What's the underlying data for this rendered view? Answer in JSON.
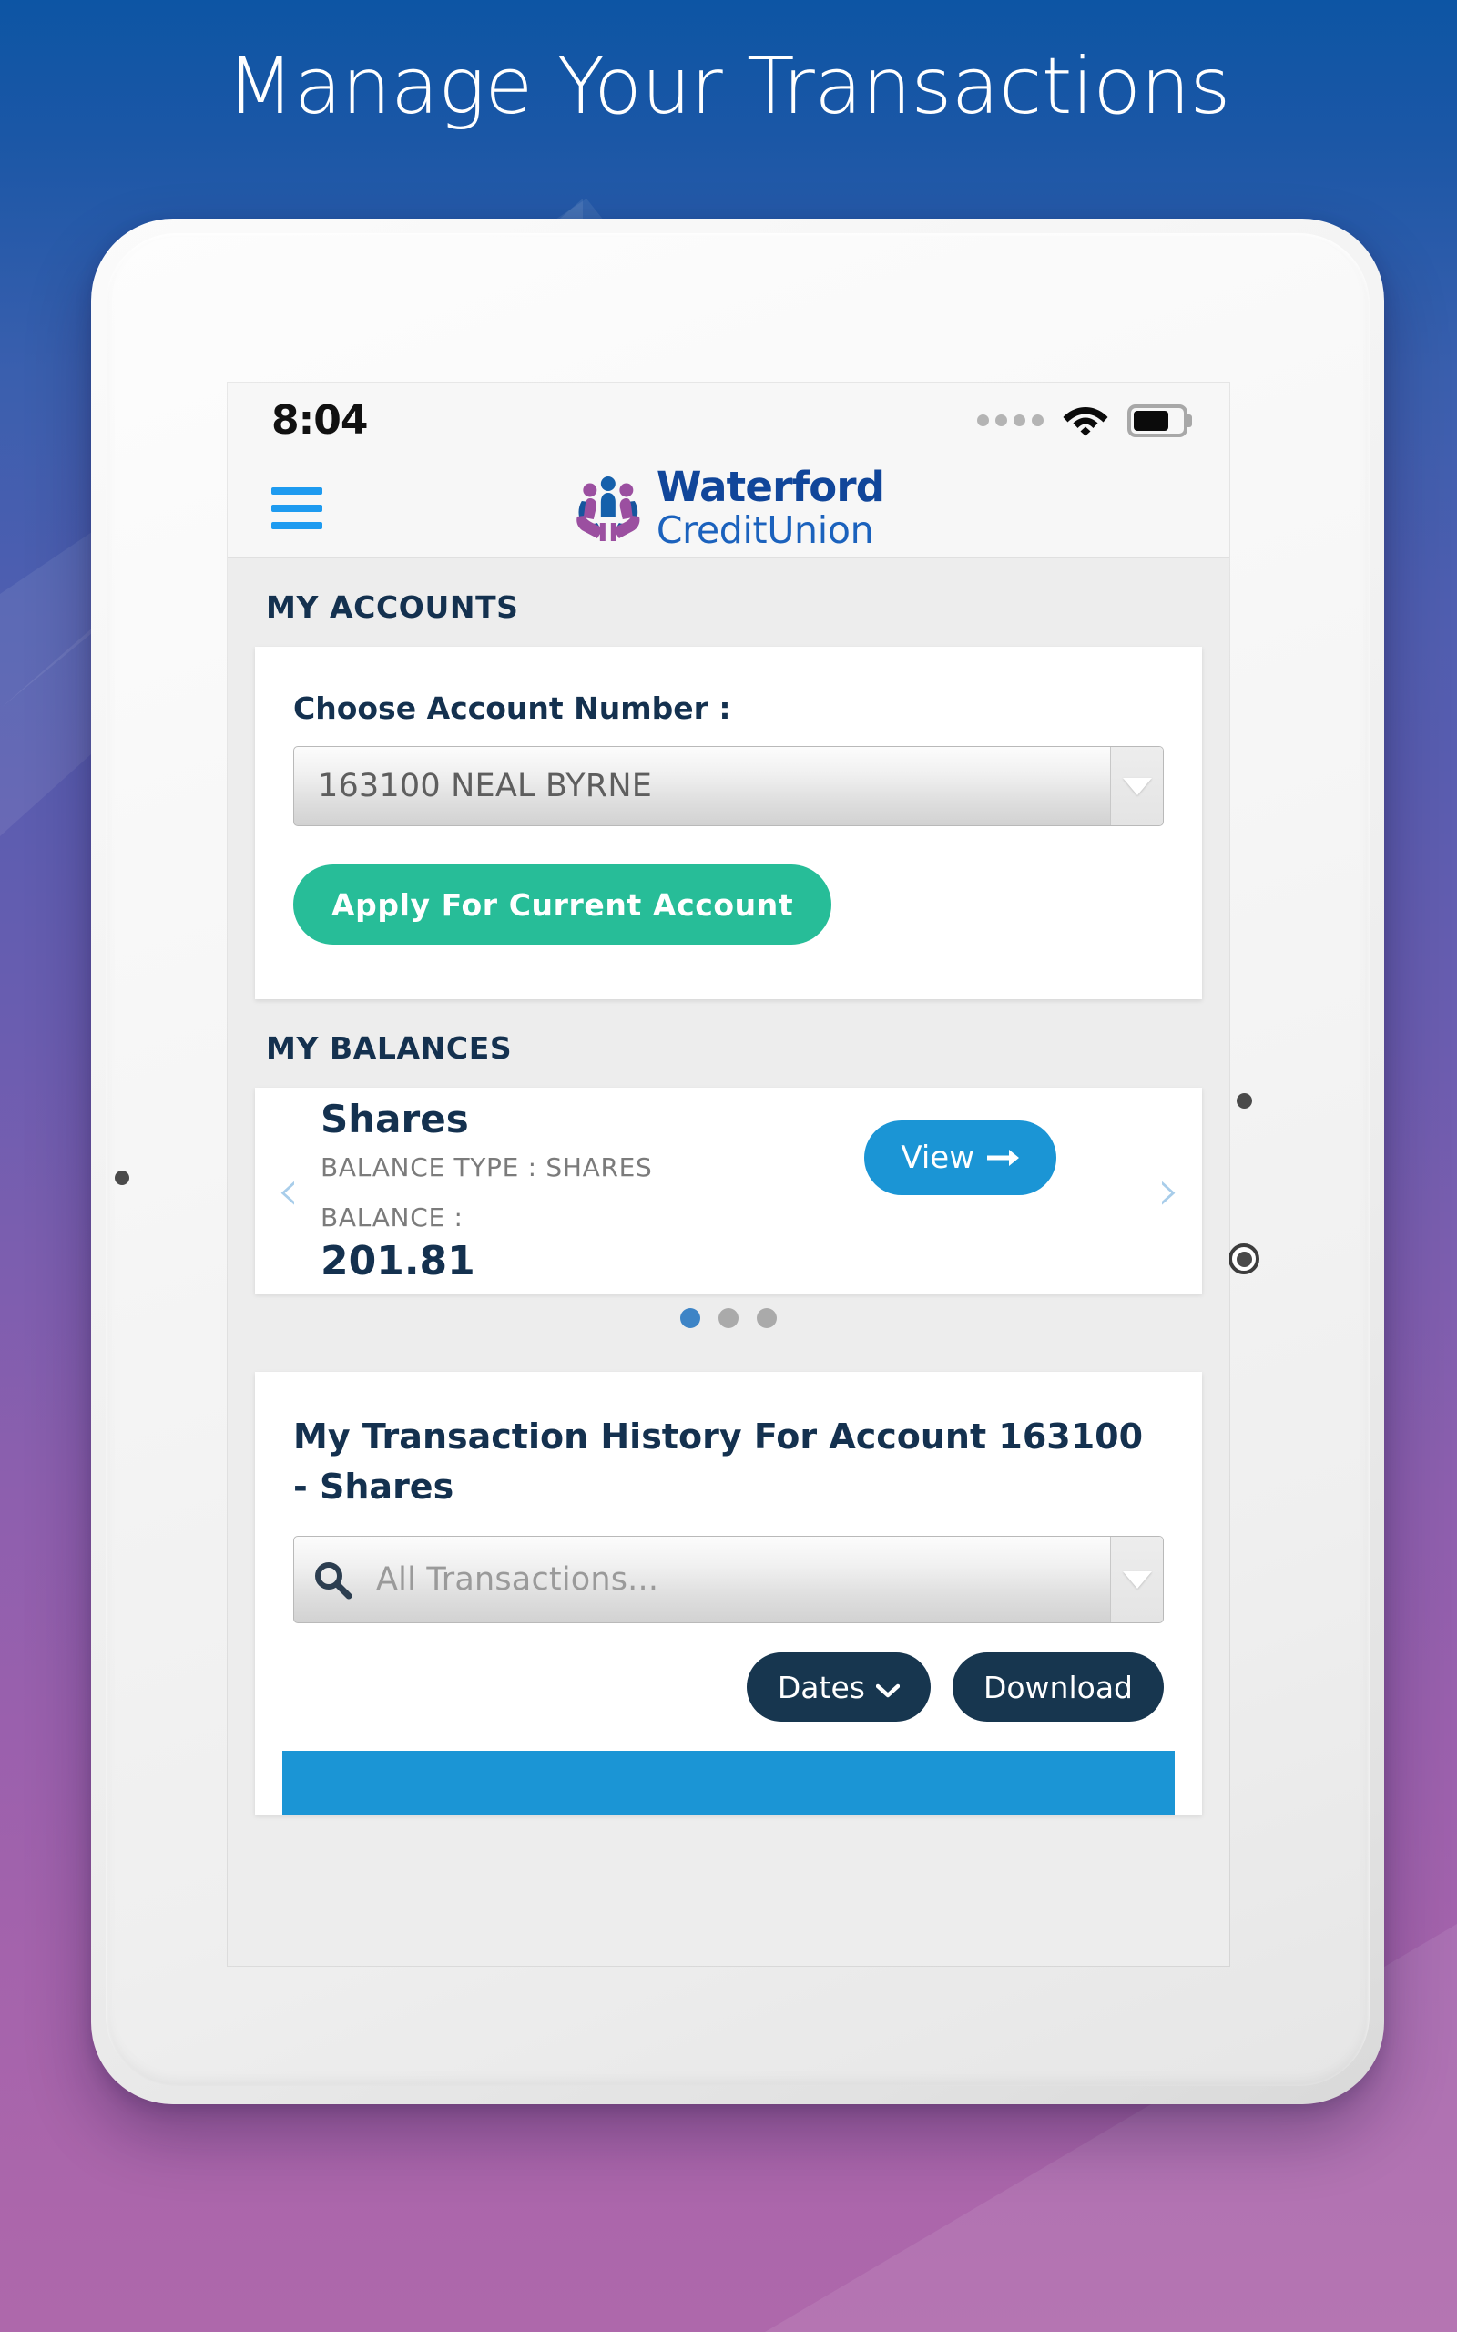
{
  "promo": {
    "title": "Manage Your Transactions",
    "background_top_color": "#0d55a4",
    "background_bottom_color": "#ae68ab"
  },
  "status_bar": {
    "time": "8:04",
    "signal_dots": 4,
    "wifi_icon": "wifi-icon",
    "battery_icon": "battery-icon",
    "battery_level": "74%"
  },
  "app_bar": {
    "menu_icon": "hamburger-menu-icon",
    "menu_color": "#1e9bf0",
    "logo": {
      "mark_icon": "waterford-credit-union-emblem",
      "line1": "Waterford",
      "line2": "CreditUnion",
      "line1_color": "#11469a",
      "line2_color": "#1b62bd"
    }
  },
  "accounts": {
    "section_title": "MY ACCOUNTS",
    "field_label": "Choose Account Number :",
    "account_select_value": "163100 NEAL BYRNE",
    "apply_button_label": "Apply For Current Account",
    "apply_button_color": "#27bd98"
  },
  "balances": {
    "section_title": "MY BALANCES",
    "card_title": "Shares",
    "balance_type_label": "BALANCE TYPE : SHARES",
    "balance_label": "BALANCE :",
    "balance_value": "201.81",
    "view_button_label": "View",
    "view_button_color": "#1b95d5",
    "prev_arrow": "‹",
    "next_arrow": "›",
    "dots_total": 3,
    "dots_active_index": 0,
    "active_dot_color": "#3d84c6"
  },
  "transactions": {
    "title": "My Transaction History For Account 163100 - Shares",
    "search_icon": "search-icon",
    "search_placeholder": "All Transactions...",
    "dates_button_label": "Dates",
    "dates_chevron": "⌄",
    "download_button_label": "Download",
    "button_color": "#17364f",
    "table_header_color": "#1b95d5"
  }
}
